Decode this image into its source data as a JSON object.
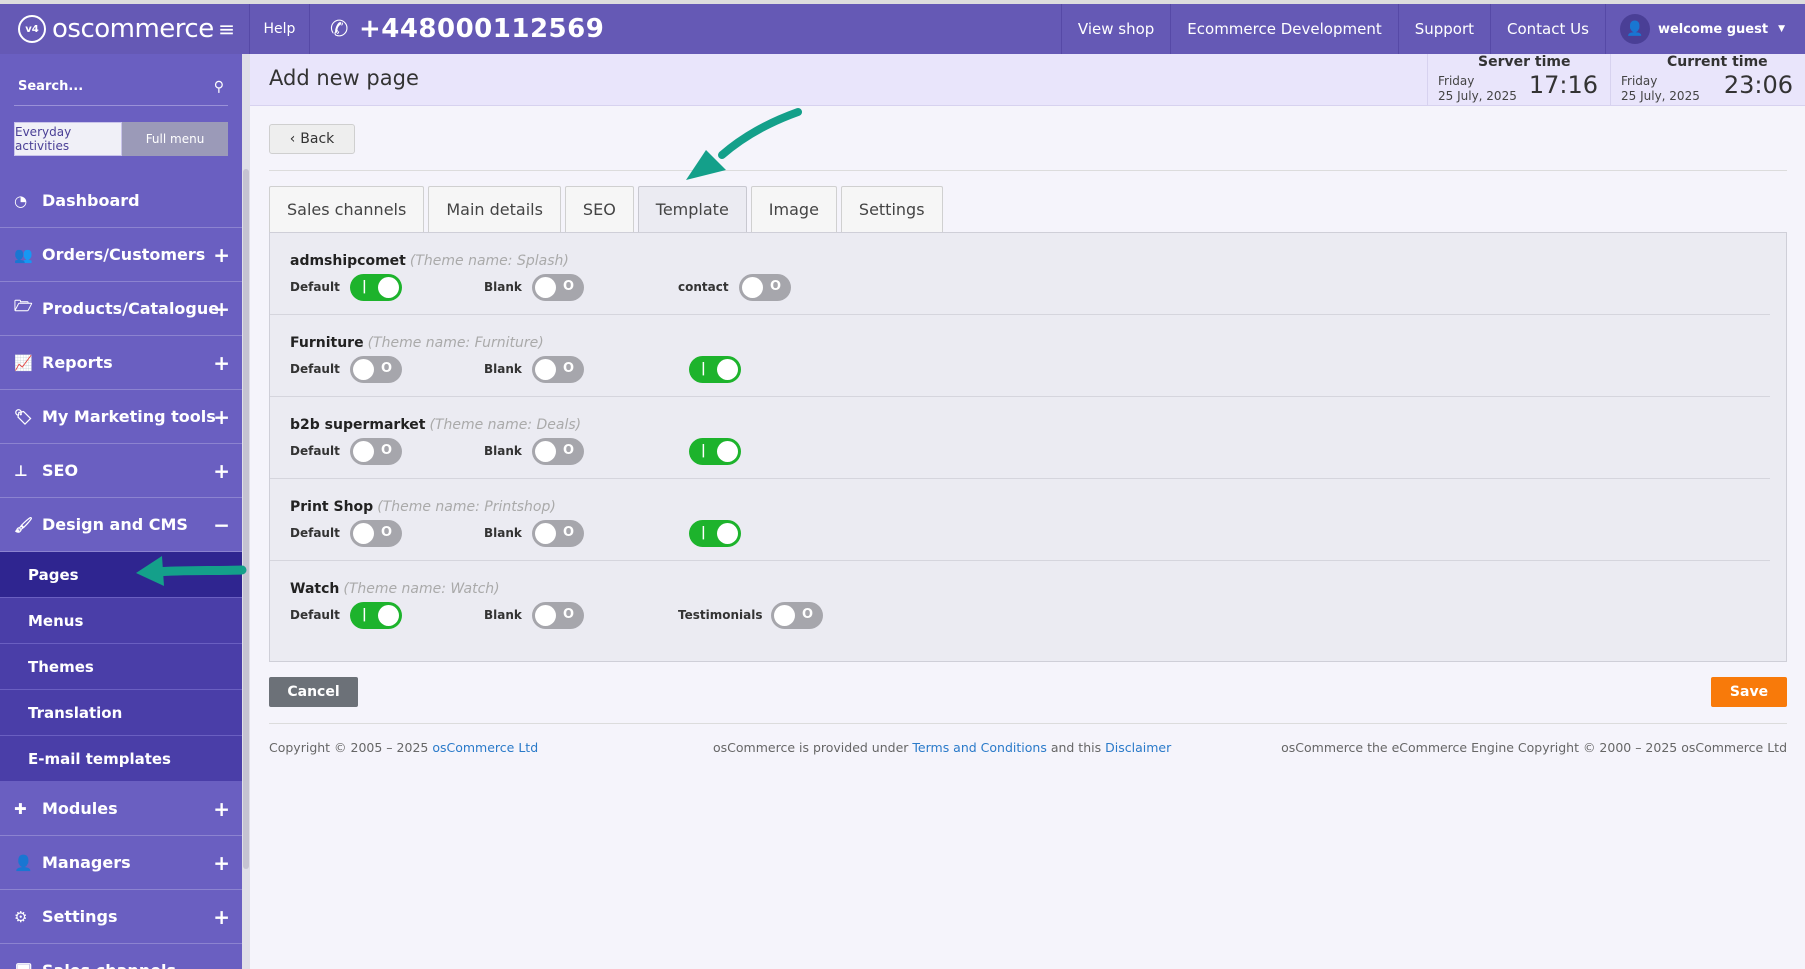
{
  "brand": {
    "logo_mark": "v4",
    "name": "oscommerce"
  },
  "topbar": {
    "help": "Help",
    "phone": "+448000112569",
    "nav": [
      "View shop",
      "Ecommerce Development",
      "Support",
      "Contact Us"
    ],
    "user": "welcome guest"
  },
  "sidebar": {
    "search_placeholder": "Search...",
    "mode_everyday": "Everyday activities",
    "mode_full": "Full menu",
    "items_top": [
      {
        "label": "Dashboard",
        "expand": ""
      },
      {
        "label": "Orders/Customers",
        "expand": "+"
      },
      {
        "label": "Products/Catalogue",
        "expand": "+"
      },
      {
        "label": "Reports",
        "expand": "+"
      },
      {
        "label": "My Marketing tools",
        "expand": "+"
      },
      {
        "label": "SEO",
        "expand": "+"
      },
      {
        "label": "Design and CMS",
        "expand": "−"
      }
    ],
    "sub_items": [
      "Pages",
      "Menus",
      "Themes",
      "Translation",
      "E-mail templates"
    ],
    "items_bottom": [
      {
        "label": "Modules",
        "expand": "+"
      },
      {
        "label": "Managers",
        "expand": "+"
      },
      {
        "label": "Settings",
        "expand": "+"
      },
      {
        "label": "Sales channels",
        "expand": ""
      }
    ]
  },
  "header": {
    "title": "Add new page",
    "server_time": {
      "label": "Server time",
      "day": "Friday",
      "date": "25 July, 2025",
      "time": "17:16"
    },
    "current_time": {
      "label": "Current time",
      "day": "Friday",
      "date": "25 July, 2025",
      "time": "23:06"
    }
  },
  "main": {
    "back": "Back",
    "tabs": [
      "Sales channels",
      "Main details",
      "SEO",
      "Template",
      "Image",
      "Settings"
    ],
    "active_tab": "Template",
    "themes": [
      {
        "name": "admshipcomet",
        "theme_name": "(Theme name: Splash)",
        "default_label": "Default",
        "default_on": true,
        "blank_label": "Blank",
        "blank_on": false,
        "extra_label": "contact",
        "extra_on": false
      },
      {
        "name": "Furniture",
        "theme_name": "(Theme name: Furniture)",
        "default_label": "Default",
        "default_on": false,
        "blank_label": "Blank",
        "blank_on": false,
        "extra_label": "",
        "extra_on": true
      },
      {
        "name": "b2b supermarket",
        "theme_name": "(Theme name: Deals)",
        "default_label": "Default",
        "default_on": false,
        "blank_label": "Blank",
        "blank_on": false,
        "extra_label": "",
        "extra_on": true
      },
      {
        "name": "Print Shop",
        "theme_name": "(Theme name: Printshop)",
        "default_label": "Default",
        "default_on": false,
        "blank_label": "Blank",
        "blank_on": false,
        "extra_label": "",
        "extra_on": true
      },
      {
        "name": "Watch",
        "theme_name": "(Theme name: Watch)",
        "default_label": "Default",
        "default_on": true,
        "blank_label": "Blank",
        "blank_on": false,
        "extra_label": "Testimonials",
        "extra_on": false
      }
    ],
    "toggle_on_glyph": "|",
    "toggle_off_glyph": "O",
    "cancel": "Cancel",
    "save": "Save"
  },
  "footer": {
    "copyright_prefix": "Copyright © 2005 – 2025",
    "copyright_link": "osCommerce Ltd",
    "mid_prefix": "osCommerce is provided under",
    "mid_link1": "Terms and Conditions",
    "mid_and": "and this",
    "mid_link2": "Disclaimer",
    "right": "osCommerce the eCommerce Engine Copyright © 2000 – 2025 osCommerce Ltd"
  },
  "colors": {
    "primary": "#6559b5",
    "sidebar": "#6a5fc1",
    "toggle_on": "#1db32c",
    "save": "#f87a0a",
    "annotation_arrow": "#14a08a"
  }
}
